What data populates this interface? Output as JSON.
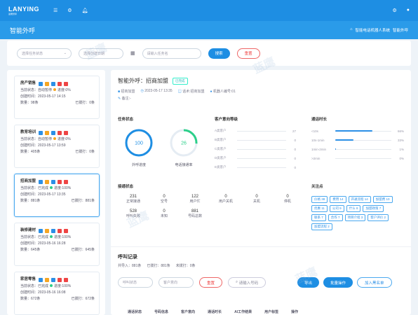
{
  "brand": {
    "name": "LANYING",
    "tagline": "蓝鹰智呼"
  },
  "page": {
    "title": "智能外呼",
    "crumb_home": "智能电话机器人系统",
    "crumb_current": "智能外呼"
  },
  "filter": {
    "status_placeholder": "选择任务状态",
    "date_start": "选择创建日期",
    "date_end": "请输入任务名",
    "search": "搜索",
    "reset": "重置"
  },
  "tasks": [
    {
      "name": "房产销售",
      "status_label": "当前状态：",
      "status": "自动暂停",
      "progress": "进度:0%",
      "time_label": "创建时间：",
      "time": "2023-05-17 14:15",
      "count_label": "数量：",
      "count": "98条",
      "called_label": "已拨打：",
      "called": "0条"
    },
    {
      "name": "教育培训",
      "status_label": "当前状态：",
      "status": "自动暂停",
      "progress": "进度:0%",
      "time_label": "创建时间：",
      "time": "2023-05-17 13:59",
      "count_label": "数量：",
      "count": "405条",
      "called_label": "已拨打：",
      "called": "0条"
    },
    {
      "name": "招商加盟",
      "status_label": "当前状态：",
      "status": "已完成",
      "progress": "进度:100%",
      "time_label": "创建时间：",
      "time": "2023-05-17 13:35",
      "count_label": "数量：",
      "count": "881条",
      "called_label": "已拨打：",
      "called": "881条"
    },
    {
      "name": "装修建材",
      "status_label": "当前状态：",
      "status": "已完成",
      "progress": "进度:100%",
      "time_label": "创建时间：",
      "time": "2023-05-16 16:28",
      "count_label": "数量：",
      "count": "645条",
      "called_label": "已拨打：",
      "called": "645条"
    },
    {
      "name": "家居零售",
      "status_label": "当前状态：",
      "status": "已完成",
      "progress": "进度:100%",
      "time_label": "创建时间：",
      "time": "2023-05-16 16:08",
      "count_label": "数量：",
      "count": "672条",
      "called_label": "已拨打：",
      "called": "672条"
    }
  ],
  "detail": {
    "title": "智能外呼：招商加盟",
    "tag": "已完成",
    "meta": [
      "招商加盟",
      "2023-05-17 13:35",
      "话术:招商加盟",
      "机器人编号:01"
    ],
    "note": "备注:-",
    "task_status_title": "任务状态",
    "ring1": {
      "value": "100",
      "label": "外呼进度",
      "pct": 1.0
    },
    "ring2": {
      "value": "26",
      "label": "电话接通率",
      "pct": 0.26
    },
    "intent_title": "客户意向等级",
    "intent": [
      {
        "name": "A类客户",
        "value": "27"
      },
      {
        "name": "B类客户",
        "value": "0"
      },
      {
        "name": "C类客户",
        "value": "0"
      },
      {
        "name": "D类客户",
        "value": "0"
      },
      {
        "name": "E类客户",
        "value": "0"
      }
    ],
    "duration_title": "通话时长",
    "duration": [
      {
        "name": "<10s",
        "value": "66%",
        "pct": 0.66
      },
      {
        "name": "10s-1min",
        "value": "33%",
        "pct": 0.33
      },
      {
        "name": "1min-2min",
        "value": "1%",
        "pct": 0.01
      },
      {
        "name": ">2min",
        "value": "0%",
        "pct": 0
      }
    ],
    "connect_title": "接通状态",
    "connect": [
      {
        "v": "231",
        "l": "正常接通"
      },
      {
        "v": "0",
        "l": "空号"
      },
      {
        "v": "122",
        "l": "用户忙"
      },
      {
        "v": "0",
        "l": "用户关机"
      },
      {
        "v": "0",
        "l": "关机"
      },
      {
        "v": "0",
        "l": "停机"
      },
      {
        "v": "528",
        "l": "呼叫失败"
      },
      {
        "v": "0",
        "l": "未知"
      },
      {
        "v": "881",
        "l": "号码总数"
      }
    ],
    "focus_title": "关注点",
    "focus": [
      "价格 38",
      "费用 14",
      "开通流程 14",
      "加盟费 10",
      "优惠 11",
      "公司 9",
      "什么 8",
      "加盟政策 7",
      "联系 7",
      "合作 7",
      "项目介绍 3",
      "客户评价 2",
      "加盟流程 2"
    ]
  },
  "calls": {
    "title": "呼叫记录",
    "total_label": "共导入：",
    "total": "881条",
    "called_label": "已拨打：",
    "called": "881条",
    "uncalled_label": "未拨打：",
    "uncalled": "0条",
    "status_placeholder": "呼叫状态",
    "intent_placeholder": "客户意向",
    "search_placeholder": "请输入号码",
    "reset": "重置",
    "btn1": "导出",
    "btn2": "批量操作",
    "btn3": "加入黑名单",
    "cols": [
      "通话状态",
      "号码信息",
      "客户意向",
      "通话时长",
      "AI工作结果",
      "用户标签",
      "操作"
    ]
  }
}
